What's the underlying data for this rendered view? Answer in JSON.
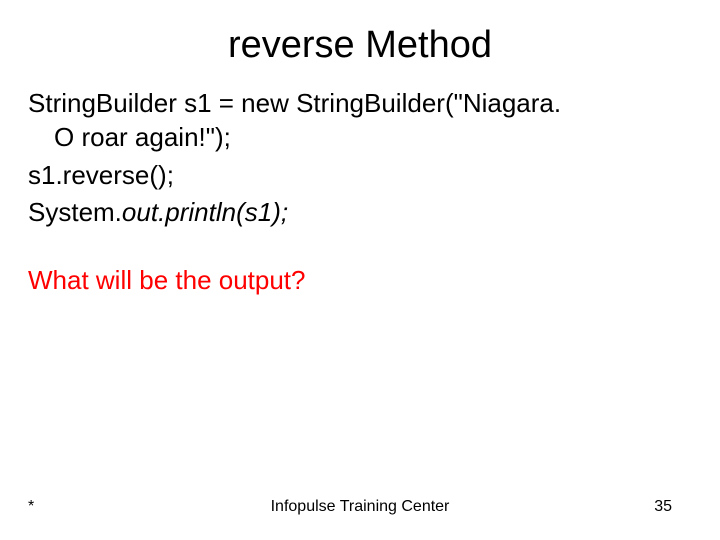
{
  "slide": {
    "title": "reverse Method",
    "lines": {
      "l1a": "StringBuilder s1 = new StringBuilder(\"Niagara.",
      "l1b": "O roar again!\");",
      "l2": "s1.reverse();",
      "l3_plain": "System.",
      "l3_italic": "out.println(s1);",
      "question": "What will be the output?"
    },
    "footer": {
      "left": "*",
      "center": "Infopulse Training Center",
      "pageNumber": "35"
    }
  }
}
